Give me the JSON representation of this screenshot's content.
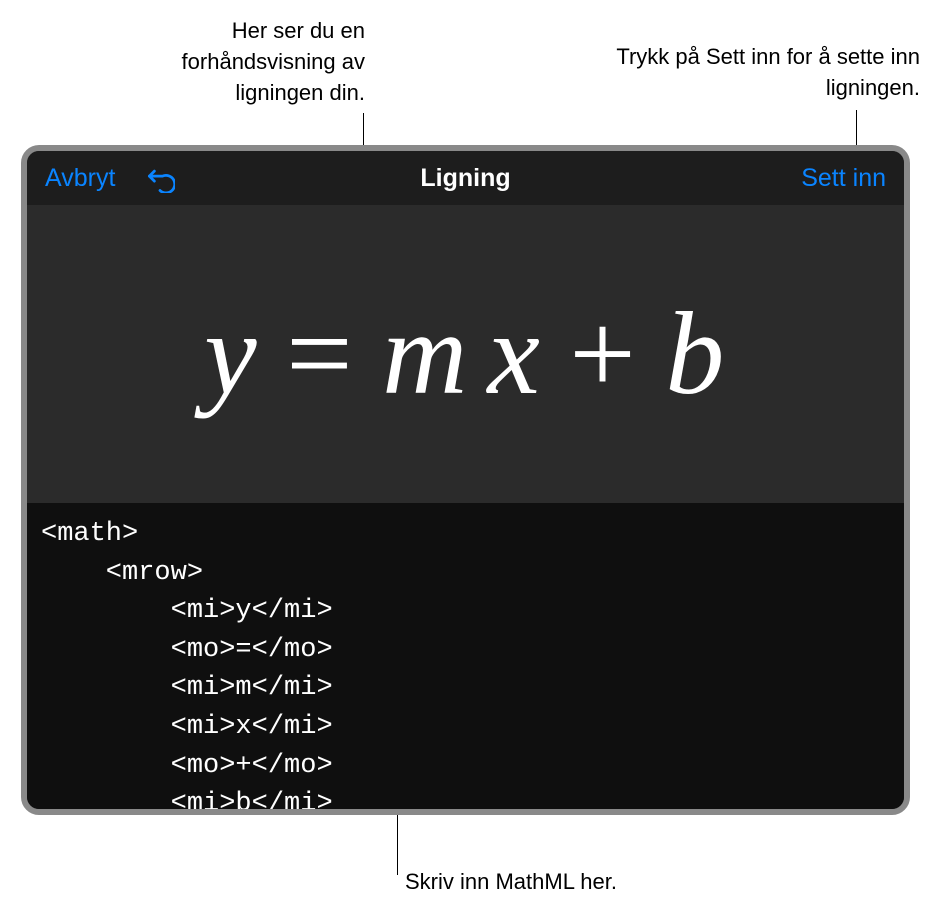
{
  "callouts": {
    "preview": "Her ser du en forhåndsvisning av ligningen din.",
    "insert": "Trykk på Sett inn for å sette inn ligningen.",
    "input": "Skriv inn MathML her."
  },
  "toolbar": {
    "cancel_label": "Avbryt",
    "title": "Ligning",
    "insert_label": "Sett inn"
  },
  "equation": {
    "y": "y",
    "eq": "=",
    "m": "m",
    "x": "x",
    "plus": "+",
    "b": "b"
  },
  "code": "<math>\n    <mrow>\n        <mi>y</mi>\n        <mo>=</mo>\n        <mi>m</mi>\n        <mi>x</mi>\n        <mo>+</mo>\n        <mi>b</mi>"
}
